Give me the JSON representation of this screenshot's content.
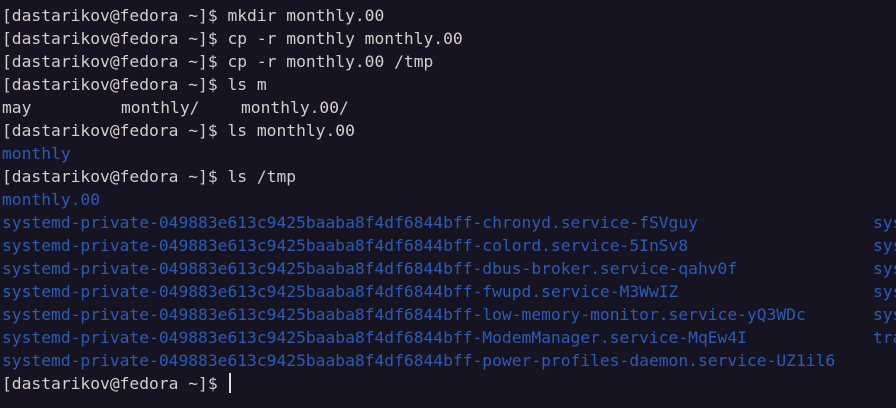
{
  "prompt": "[dastarikov@fedora ~]$ ",
  "colors": {
    "background": "#171421",
    "foreground": "#d0cfcc",
    "directory": "#2a5bb8"
  },
  "history": [
    {
      "command": "mkdir monthly.00"
    },
    {
      "command": "cp -r monthly monthly.00"
    },
    {
      "command": "cp -r monthly.00 /tmp"
    },
    {
      "command": "ls m"
    }
  ],
  "ls_m_output": [
    "may",
    "monthly/",
    "monthly.00/"
  ],
  "cmd_ls_monthly00": "ls monthly.00",
  "ls_monthly00_output": [
    "monthly"
  ],
  "cmd_ls_tmp": "ls /tmp",
  "ls_tmp_output_col1": [
    "monthly.00",
    "systemd-private-049883e613c9425baaba8f4df6844bff-chronyd.service-fSVguy",
    "systemd-private-049883e613c9425baaba8f4df6844bff-colord.service-5InSv8",
    "systemd-private-049883e613c9425baaba8f4df6844bff-dbus-broker.service-qahv0f",
    "systemd-private-049883e613c9425baaba8f4df6844bff-fwupd.service-M3WwIZ",
    "systemd-private-049883e613c9425baaba8f4df6844bff-low-memory-monitor.service-yQ3WDc",
    "systemd-private-049883e613c9425baaba8f4df6844bff-ModemManager.service-MqEw4I",
    "systemd-private-049883e613c9425baaba8f4df6844bff-power-profiles-daemon.service-UZ1il6"
  ],
  "ls_tmp_output_col2": [
    "",
    "sys",
    "sys",
    "sys",
    "sys",
    "sys",
    "tra",
    ""
  ]
}
